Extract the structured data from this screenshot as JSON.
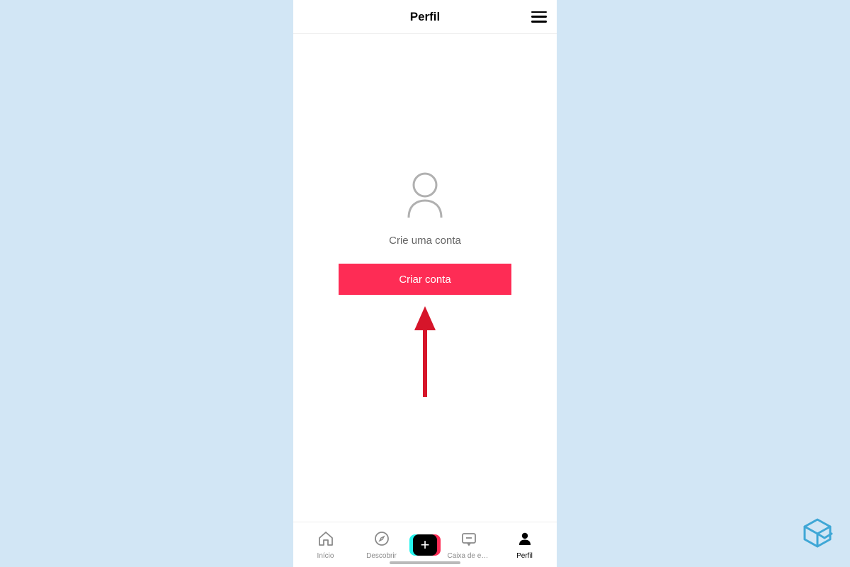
{
  "header": {
    "title": "Perfil"
  },
  "content": {
    "prompt": "Crie uma conta",
    "button_label": "Criar conta"
  },
  "nav": {
    "home": "Início",
    "discover": "Descobrir",
    "inbox": "Caixa de entr...",
    "profile": "Perfil"
  }
}
